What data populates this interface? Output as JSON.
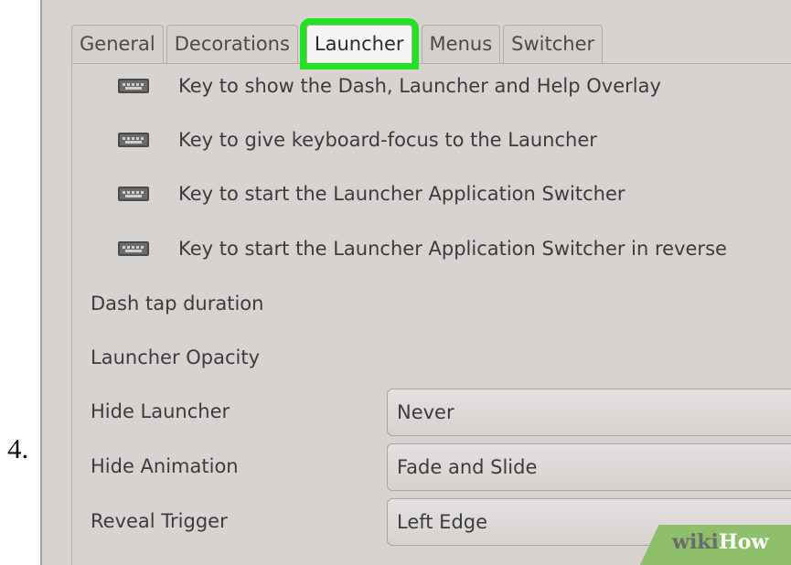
{
  "step": {
    "number": "4."
  },
  "tabs": [
    {
      "label": "General"
    },
    {
      "label": "Decorations"
    },
    {
      "label": "Launcher",
      "active": true
    },
    {
      "label": "Menus"
    },
    {
      "label": "Switcher"
    }
  ],
  "highlight_color": "#22e022",
  "keybindings": [
    {
      "label": "Key to show the Dash, Launcher and Help Overlay",
      "icon": "keyboard-icon"
    },
    {
      "label": "Key to give keyboard-focus to the Launcher",
      "icon": "keyboard-icon"
    },
    {
      "label": "Key to start the Launcher Application Switcher",
      "icon": "keyboard-icon"
    },
    {
      "label": "Key to start the Launcher Application Switcher in reverse",
      "icon": "keyboard-icon"
    }
  ],
  "settings": {
    "dash_tap_duration": "Dash tap duration",
    "launcher_opacity": "Launcher Opacity",
    "hide_launcher": {
      "label": "Hide Launcher",
      "value": "Never"
    },
    "hide_animation": {
      "label": "Hide Animation",
      "value": "Fade and Slide"
    },
    "reveal_trigger": {
      "label": "Reveal Trigger",
      "value": "Left Edge"
    }
  },
  "watermark": {
    "part1": "wiki",
    "part2": "How"
  }
}
